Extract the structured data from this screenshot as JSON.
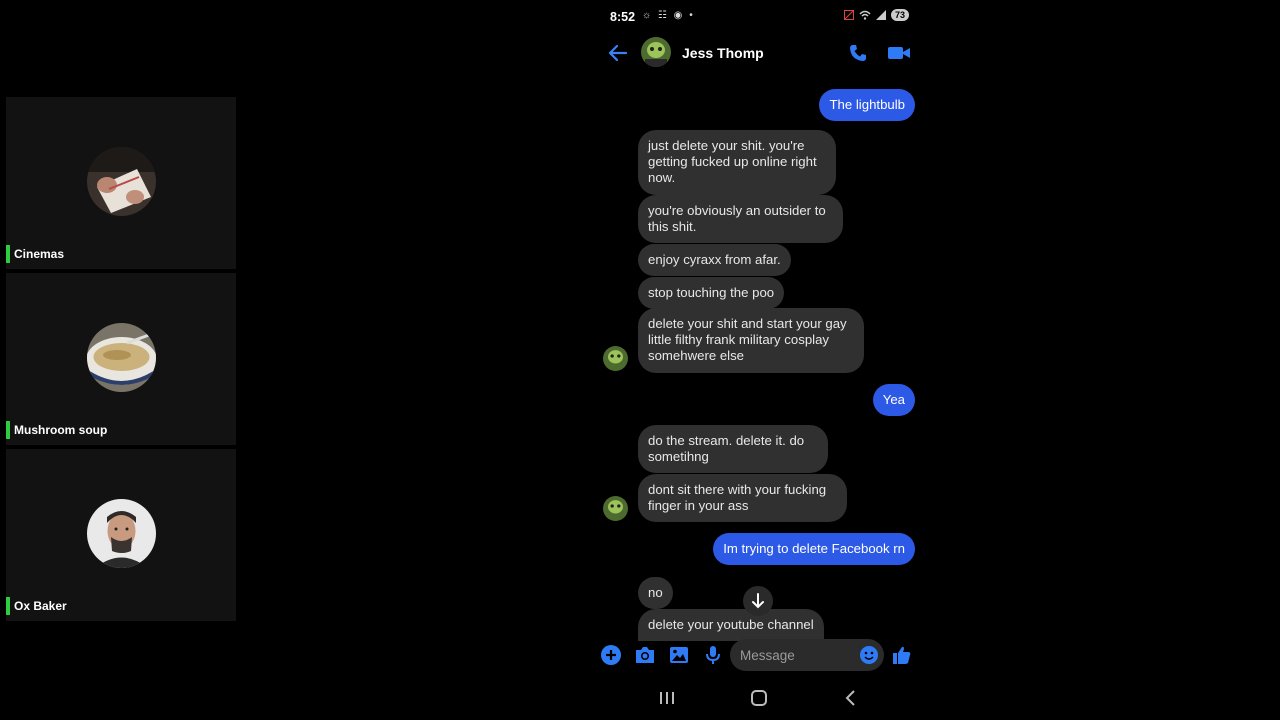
{
  "participants": [
    {
      "name": "Cinemas",
      "avatar_icon": "photo-of-hands-with-paper"
    },
    {
      "name": "Mushroom soup",
      "avatar_icon": "bowl-of-soup"
    },
    {
      "name": "Ox Baker",
      "avatar_icon": "man-with-mustache"
    }
  ],
  "status_bar": {
    "time": "8:52",
    "left_icons": "☼ ☷ ◉ •",
    "battery": "73"
  },
  "header": {
    "contact_name": "Jess Thomp"
  },
  "messages": [
    {
      "side": "out",
      "text": "The lightbulb"
    },
    {
      "side": "in",
      "text": "just delete your shit.  you're getting fucked up online right now."
    },
    {
      "side": "in",
      "text": "you're obviously an outsider to this shit."
    },
    {
      "side": "in",
      "text": "enjoy cyraxx from afar."
    },
    {
      "side": "in",
      "text": "stop touching the poo"
    },
    {
      "side": "in",
      "text": "delete your shit and start your gay little filthy frank military cosplay somehwere else"
    },
    {
      "side": "out",
      "text": "Yea"
    },
    {
      "side": "in",
      "text": "do the stream.  delete it.  do sometihng"
    },
    {
      "side": "in",
      "text": "dont sit there with your fucking finger in your ass"
    },
    {
      "side": "out",
      "text": "Im trying to delete Facebook rn"
    },
    {
      "side": "in",
      "text": "no"
    },
    {
      "side": "in",
      "text": "delete your youtube channel"
    }
  ],
  "composer": {
    "placeholder": "Message"
  },
  "colors": {
    "accent": "#2c59e6",
    "bubble_in": "#303030",
    "indicator": "#2ecc40"
  }
}
